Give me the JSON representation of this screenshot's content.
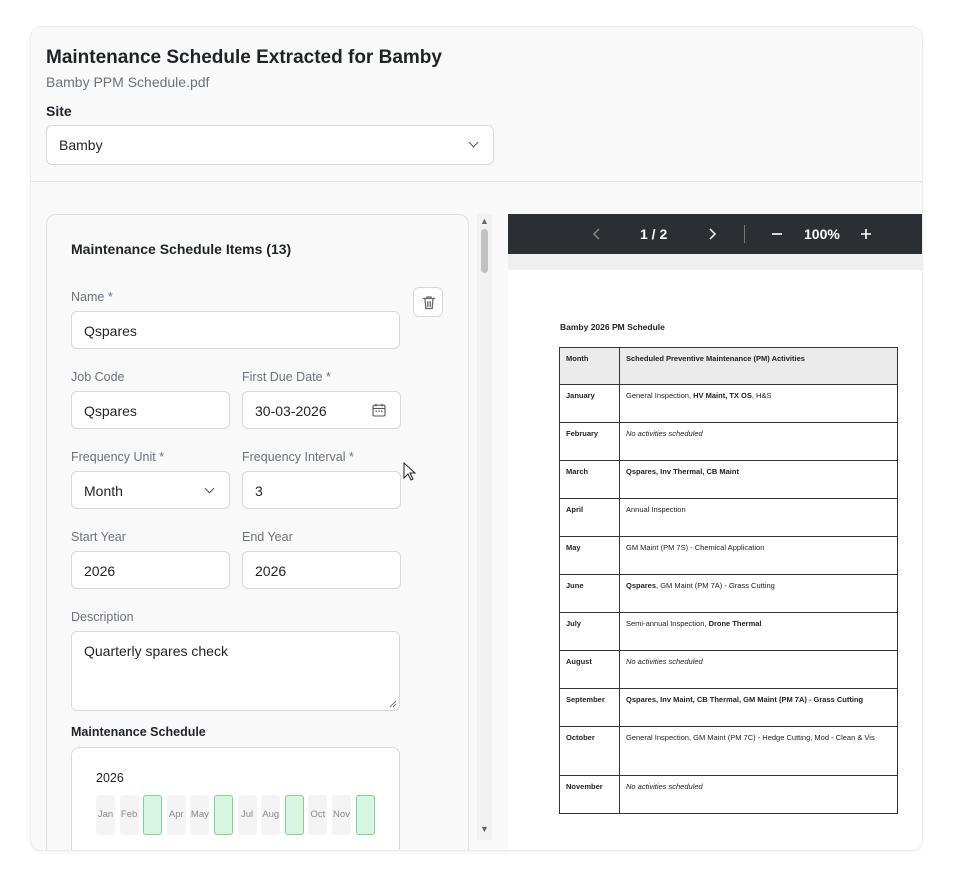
{
  "header": {
    "title": "Maintenance Schedule Extracted for Bamby",
    "subtitle": "Bamby PPM Schedule.pdf",
    "site_label": "Site",
    "site_value": "Bamby"
  },
  "form": {
    "panel_title": "Maintenance Schedule Items (13)",
    "name_label": "Name *",
    "name_value": "Qspares",
    "job_code_label": "Job Code",
    "job_code_value": "Qspares",
    "first_due_label": "First Due Date *",
    "first_due_value": "30-03-2026",
    "freq_unit_label": "Frequency Unit *",
    "freq_unit_value": "Month",
    "freq_interval_label": "Frequency Interval *",
    "freq_interval_value": "3",
    "start_year_label": "Start Year",
    "start_year_value": "2026",
    "end_year_label": "End Year",
    "end_year_value": "2026",
    "description_label": "Description",
    "description_value": "Quarterly spares check",
    "schedule_title": "Maintenance Schedule",
    "schedule_year": "2026",
    "months": [
      {
        "label": "Jan",
        "on": false
      },
      {
        "label": "Feb",
        "on": false
      },
      {
        "label": "",
        "on": true
      },
      {
        "label": "Apr",
        "on": false
      },
      {
        "label": "May",
        "on": false
      },
      {
        "label": "",
        "on": true
      },
      {
        "label": "Jul",
        "on": false
      },
      {
        "label": "Aug",
        "on": false
      },
      {
        "label": "",
        "on": true
      },
      {
        "label": "Oct",
        "on": false
      },
      {
        "label": "Nov",
        "on": false
      },
      {
        "label": "",
        "on": true
      }
    ]
  },
  "viewer": {
    "page_indicator": "1 / 2",
    "zoom": "100%",
    "doc_title": "Bamby 2026 PM Schedule",
    "col_month": "Month",
    "col_activities": "Scheduled Preventive Maintenance (PM) Activities",
    "rows": [
      {
        "month": "January",
        "parts": [
          {
            "t": "General Inspection, ",
            "s": "n"
          },
          {
            "t": "HV Maint, TX OS",
            "s": "b"
          },
          {
            "t": ", H&S",
            "s": "n"
          }
        ]
      },
      {
        "month": "February",
        "parts": [
          {
            "t": "No activities scheduled",
            "s": "i"
          }
        ]
      },
      {
        "month": "March",
        "parts": [
          {
            "t": "Qspares, Inv Thermal, CB Maint",
            "s": "b"
          }
        ]
      },
      {
        "month": "April",
        "parts": [
          {
            "t": "Annual Inspection",
            "s": "n"
          }
        ]
      },
      {
        "month": "May",
        "parts": [
          {
            "t": "GM Maint (PM 7S) - Chemical Application",
            "s": "n"
          }
        ]
      },
      {
        "month": "June",
        "parts": [
          {
            "t": "Qspares",
            "s": "b"
          },
          {
            "t": ", GM Maint (PM 7A) - Grass Cutting",
            "s": "n"
          }
        ]
      },
      {
        "month": "July",
        "parts": [
          {
            "t": "Semi-annual Inspection, ",
            "s": "n"
          },
          {
            "t": "Drone Thermal",
            "s": "b"
          }
        ]
      },
      {
        "month": "August",
        "parts": [
          {
            "t": "No activities scheduled",
            "s": "i"
          }
        ]
      },
      {
        "month": "September",
        "parts": [
          {
            "t": "Qspares, Inv Maint, CB Thermal, GM Maint (PM 7A) - Grass Cutting",
            "s": "b"
          }
        ]
      },
      {
        "month": "October",
        "parts": [
          {
            "t": "General Inspection, GM Maint (PM 7C) - Hedge Cutting, Mod - Clean & Vis",
            "s": "n"
          }
        ]
      },
      {
        "month": "November",
        "parts": [
          {
            "t": "No activities scheduled",
            "s": "i"
          }
        ]
      }
    ]
  }
}
